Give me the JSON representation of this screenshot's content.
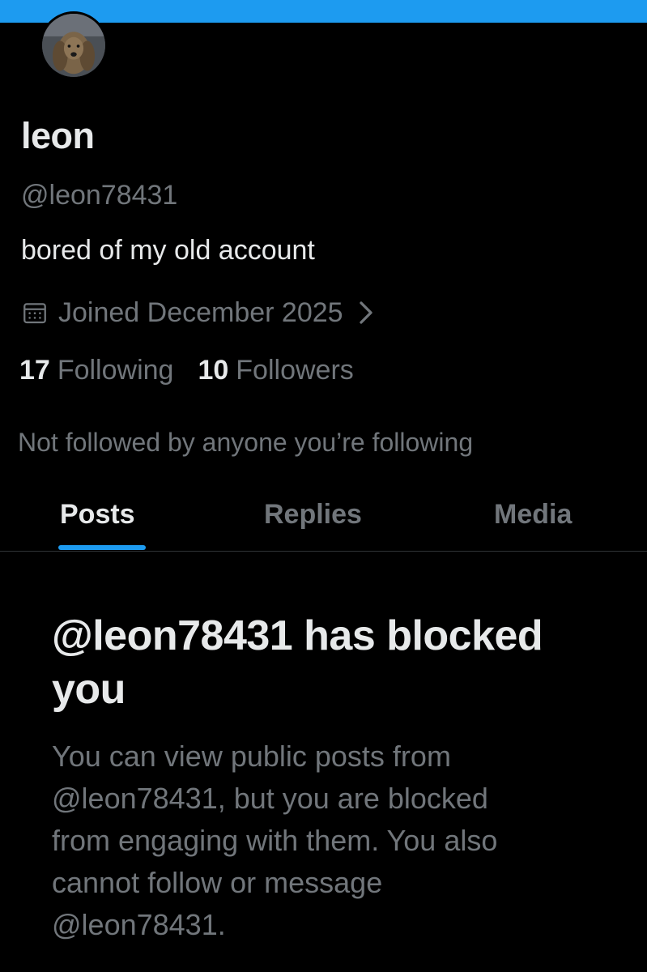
{
  "theme": {
    "accent": "#1d9bf0",
    "background": "#000000",
    "text_primary": "#e7e9ea",
    "text_secondary": "#71767b"
  },
  "profile": {
    "display_name": "leon",
    "handle": "@leon78431",
    "bio": "bored of my old account",
    "joined": "Joined December 2025",
    "following_count": "17",
    "following_label": "Following",
    "followers_count": "10",
    "followers_label": "Followers",
    "followed_by_note": "Not followed by anyone you’re following",
    "icons": {
      "avatar": "dog-photo-avatar",
      "joined": "calendar-icon",
      "joined_more": "chevron-right-icon"
    }
  },
  "tabs": [
    {
      "label": "Posts",
      "active": true
    },
    {
      "label": "Replies",
      "active": false
    },
    {
      "label": "Media",
      "active": false
    }
  ],
  "blocked_notice": {
    "title": "@leon78431 has blocked you",
    "body": "You can view public posts from @leon78431, but you are blocked from engaging with them. You also cannot follow or message @leon78431."
  }
}
